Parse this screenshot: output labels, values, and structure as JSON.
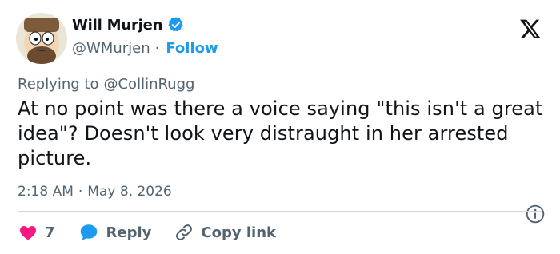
{
  "author": {
    "name": "Will Murjen",
    "handle": "@WMurjen",
    "follow_label": "Follow",
    "separator": "·"
  },
  "reply": {
    "prefix": "Replying to",
    "mention": "@CollinRugg"
  },
  "tweet": {
    "text": "At no point was there a voice saying \"this isn't a great idea\"? Doesn't look very distraught in her arrested picture."
  },
  "meta": {
    "time": "2:18 AM",
    "separator": "·",
    "date": "May 8, 2026"
  },
  "actions": {
    "like_count": "7",
    "reply_label": "Reply",
    "copy_label": "Copy link"
  },
  "colors": {
    "accent": "#1d9bf0",
    "like": "#f91880",
    "text": "#0f1419",
    "muted": "#536471"
  },
  "icons": {
    "verified": "verified-badge-icon",
    "brand": "x-logo-icon",
    "info": "info-icon",
    "like": "heart-icon",
    "reply": "reply-bubble-icon",
    "copy": "link-icon"
  }
}
